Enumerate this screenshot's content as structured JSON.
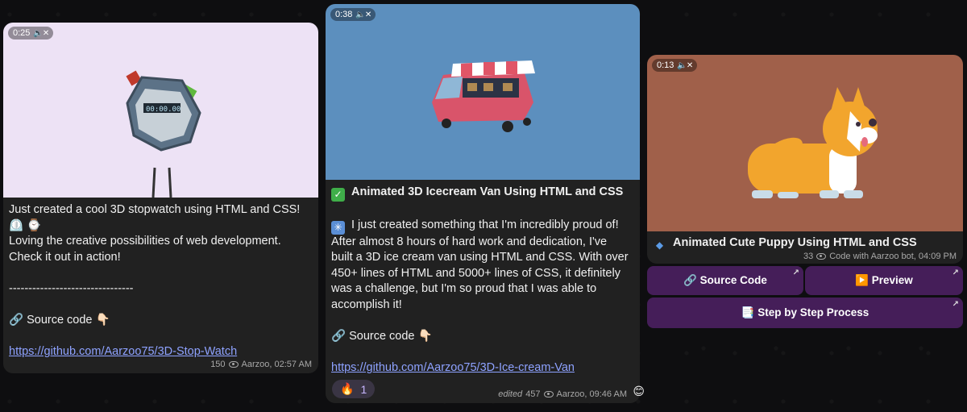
{
  "colors": {
    "card_bg": "#212121",
    "link": "#8ea2ff",
    "card1_media_bg": "#ede2f5",
    "card2_media_bg": "#5c8fbe",
    "card3_media_bg": "#a0604a",
    "button_bg": "#4a205f"
  },
  "card1": {
    "duration": "0:25",
    "mute_icon": "muted-speaker-icon",
    "lines": [
      "Just created a cool 3D stopwatch using HTML and CSS!",
      "⏲️ ⌚",
      "Loving the creative possibilities of web development.",
      "Check it out in action!",
      "",
      "--------------------------------",
      "",
      "🔗 Source code 👇🏻",
      "",
      "https://github.com/Aarzoo75/3D-Stop-Watch"
    ],
    "views": "150",
    "author_time": "Aarzoo, 02:57 AM"
  },
  "card2": {
    "duration": "0:38",
    "mute_icon": "muted-speaker-icon",
    "title_icon": "check-mark-icon",
    "title": "Animated 3D Icecream Van Using HTML and CSS",
    "intro_icon": "sparkle-icon",
    "lines": [
      "I just created something that I'm incredibly proud of!",
      "After almost 8 hours of hard work and dedication, I've",
      "built a 3D ice cream van using HTML and CSS. With over",
      "450+ lines of HTML and 5000+ lines of CSS, it definitely",
      "was a challenge, but I'm so proud that I was able to",
      "accomplish it!",
      "",
      "🔗  Source code 👇🏻",
      "",
      "https://github.com/Aarzoo75/3D-Ice-cream-Van"
    ],
    "reaction_emoji": "🔥",
    "reaction_count": "1",
    "edited": "edited",
    "views": "457",
    "author_time": "Aarzoo, 09:46 AM",
    "side_emoji": "😊"
  },
  "card3": {
    "duration": "0:13",
    "mute_icon": "muted-speaker-icon",
    "title_icon": "blue-diamond-icon",
    "title": "Animated Cute Puppy Using HTML and CSS",
    "views": "33",
    "author_time": "Code with Aarzoo bot, 04:09 PM"
  },
  "buttons": {
    "source_code": "🔗 Source Code",
    "preview": "▶️ Preview",
    "step_by_step": "📑 Step by Step Process",
    "arrow": "↗"
  }
}
